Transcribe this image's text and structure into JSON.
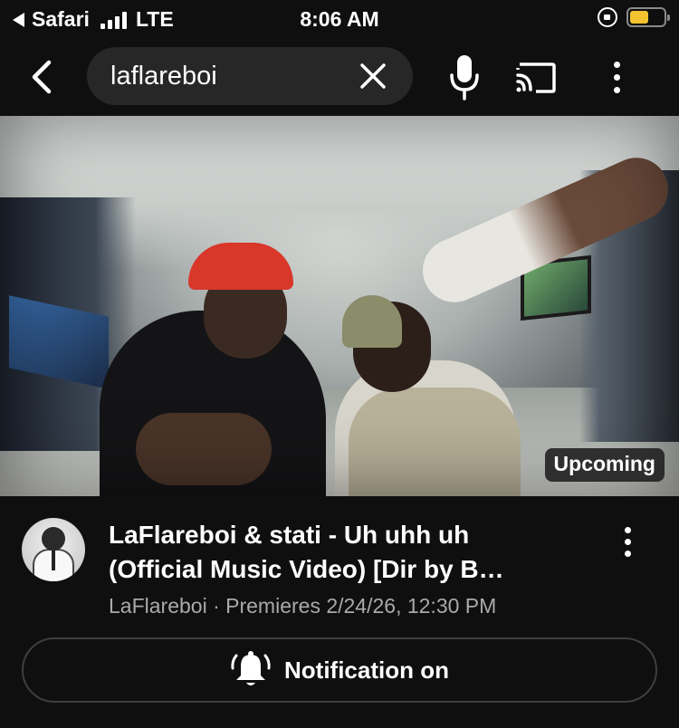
{
  "status_bar": {
    "back_app": "Safari",
    "network": "LTE",
    "time": "8:06 AM",
    "icons": [
      "back-triangle-icon",
      "signal-icon",
      "rotation-lock-icon",
      "battery-icon"
    ],
    "battery_color": "#f4c430"
  },
  "header": {
    "query": "laflareboi",
    "icons": [
      "back-arrow-icon",
      "clear-icon",
      "microphone-icon",
      "cast-icon",
      "more-vert-icon"
    ]
  },
  "video": {
    "badge": "Upcoming",
    "title_line1": "LaFlareboi & stati - Uh uhh uh",
    "title_line2": "(Official Music Video) [Dir by B…",
    "channel": "LaFlareboi",
    "separator": "·",
    "premiere": "Premieres 2/24/26, 12:30 PM"
  },
  "notification": {
    "label": "Notification on",
    "icon": "bell-ringing-icon"
  },
  "colors": {
    "background": "#0f0f0f",
    "search_bg": "#272727",
    "meta_text": "#aaaaaa"
  }
}
